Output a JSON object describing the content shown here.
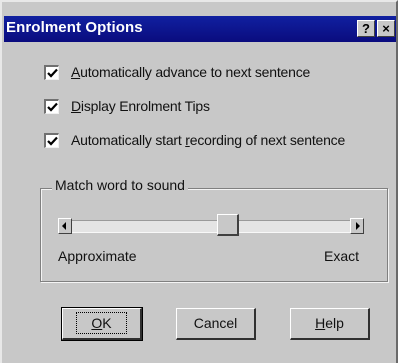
{
  "window": {
    "title": "Enrolment Options",
    "help_glyph": "?",
    "close_glyph": "×"
  },
  "options": [
    {
      "label": "Automatically advance to next sentence",
      "mnemonic": "A",
      "checked": true
    },
    {
      "label": "Display Enrolment Tips",
      "mnemonic": "D",
      "checked": true
    },
    {
      "label": "Automatically start recording of next sentence",
      "mnemonic": "r",
      "checked": true
    }
  ],
  "match_group": {
    "legend": "Match word to sound",
    "min_label": "Approximate",
    "max_label": "Exact",
    "level": 0.5
  },
  "buttons": {
    "ok": "OK",
    "cancel": "Cancel",
    "help": "Help"
  },
  "colors": {
    "titlebar": "#0a0c7e",
    "dialog_face": "#c8c8c8"
  }
}
